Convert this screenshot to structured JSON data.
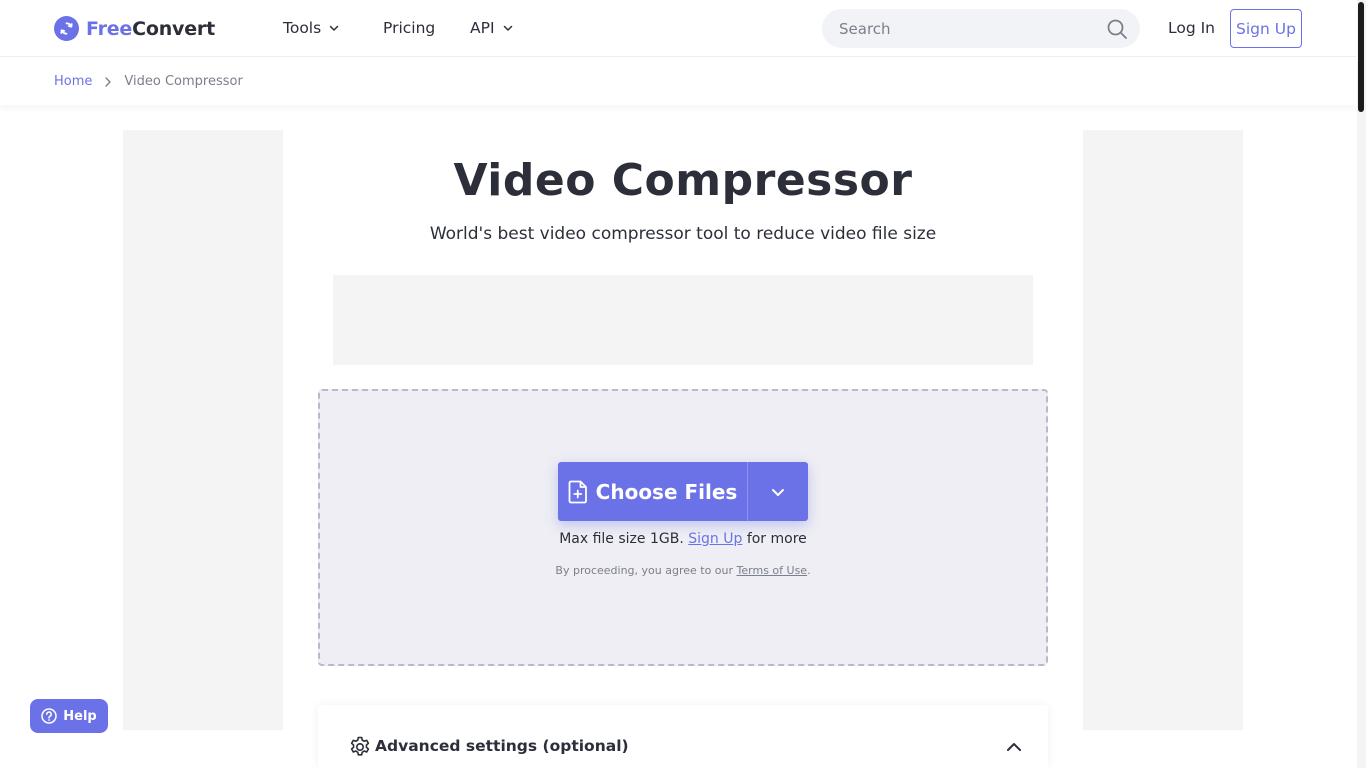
{
  "brand": {
    "name_part1": "Free",
    "name_part2": "Convert",
    "accent": "#6b72e8"
  },
  "nav": {
    "tools": "Tools",
    "pricing": "Pricing",
    "api": "API"
  },
  "search": {
    "placeholder": "Search"
  },
  "auth": {
    "login": "Log In",
    "signup": "Sign Up"
  },
  "breadcrumb": {
    "home": "Home",
    "current": "Video Compressor"
  },
  "main": {
    "title": "Video Compressor",
    "subtitle": "World's best video compressor tool to reduce video file size"
  },
  "upload": {
    "choose_label": "Choose Files",
    "max_prefix": "Max file size 1GB.",
    "max_link": "Sign Up",
    "max_suffix": "for more",
    "terms_prefix": "By proceeding, you agree to our",
    "terms_link": "Terms of Use",
    "terms_suffix": "."
  },
  "advanced": {
    "label": "Advanced settings (optional)"
  },
  "help": {
    "label": "Help"
  }
}
